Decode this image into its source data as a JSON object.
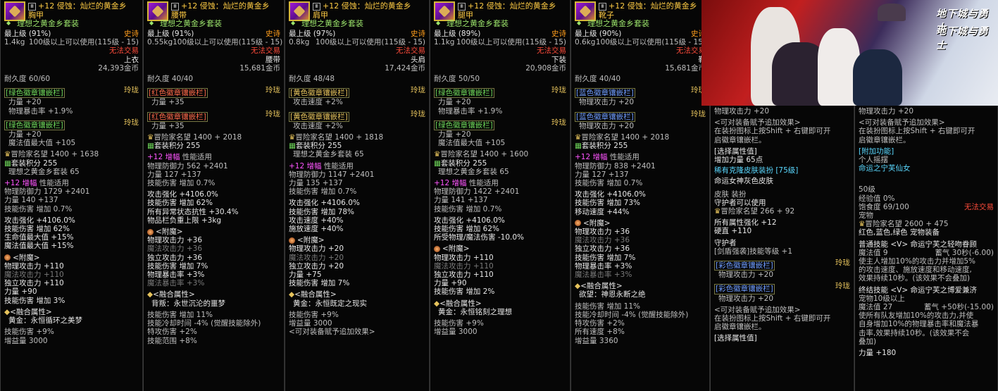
{
  "panels": [
    {
      "title": "+12 侵蚀：灿烂的黄金乡",
      "slot_name": "胸甲",
      "set_name": "理想之黄金乡套装",
      "grade": "最上级 (91%)",
      "rarity": "史诗",
      "weight": "1.4kg",
      "level_req": "100级以上可以使用(115级 - 15)",
      "trade": "无法交易",
      "type": "上衣",
      "price": "24,393金币",
      "durability": "耐久度 60/60",
      "sockets": [
        {
          "name": "[绿色徽章镶嵌栏]",
          "tag": "玲珑",
          "lines": [
            "力量 +20",
            "物理暴击率 +1.9%"
          ]
        },
        {
          "name": "[绿色徽章镶嵌栏]",
          "tag": "玲珑",
          "lines": [
            "力量 +20",
            "魔法值最大值 +105"
          ]
        }
      ],
      "fame": "冒险家名望 1400 + 1638",
      "set_points": "套装积分 255",
      "set_points_name": "理想之黄金乡套装 65",
      "amp_title": "+12 增幅",
      "amp_suffix": "性能适用",
      "stats": [
        "物理防御力 1729 +2401",
        "力量 140 +137",
        "技能伤害 增加 0.7%"
      ],
      "options": [
        "攻击强化 +4106.0%",
        "技能伤害 增加 62%",
        "生命值最大值 +15%",
        "魔法值最大值 +15%"
      ],
      "enchant_title": "<附魔>",
      "enchant": [
        "物理攻击力 +110",
        "魔法攻击力 +110",
        "独立攻击力 +110",
        "力量 +90",
        "技能伤害 增加 3%"
      ],
      "fusion_title": "<融合属性>",
      "fusion": "黄金：永恒循环之美梦",
      "tail": [
        "技能伤害 +9%",
        "增益量 3000"
      ]
    },
    {
      "title": "+12 侵蚀：灿烂的黄金乡",
      "slot_name": "腰带",
      "set_name": "理想之黄金乡套装",
      "grade": "最上级 (91%)",
      "rarity": "史诗",
      "weight": "0.55kg",
      "level_req": "100级以上可以使用(115级 - 15)",
      "trade": "无法交易",
      "type": "腰带",
      "price": "15,681金币",
      "durability": "耐久度 40/40",
      "sockets": [
        {
          "name": "[红色徽章镶嵌栏]",
          "tag": "玲珑",
          "lines": [
            "力量 +35"
          ]
        },
        {
          "name": "[红色徽章镶嵌栏]",
          "tag": "玲珑",
          "lines": [
            "力量 +35"
          ]
        }
      ],
      "fame": "冒险家名望 1400 + 2018",
      "set_points": "套装积分 255",
      "set_points_name": "",
      "amp_title": "+12 增幅",
      "amp_suffix": "性能适用",
      "stats": [
        "物理防御力 562 +2401",
        "力量 127 +137",
        "技能伤害 增加 0.7%"
      ],
      "options": [
        "攻击强化 +4106.0%",
        "技能伤害 增加 62%",
        "所有异常状态抗性 +30.4%",
        "物品栏负重上限 +3kg"
      ],
      "enchant_title": "<附魔>",
      "enchant": [
        "物理攻击力 +36",
        "魔法攻击力 +36",
        "独立攻击力 +36",
        "技能伤害 增加 7%",
        "物理暴击率 +3%",
        "魔法暴击率 +3%"
      ],
      "fusion_title": "<融合属性>",
      "fusion": "背叛：永世沉沦的噩梦",
      "tail": [
        "技能伤害 增加 11%",
        "技能冷却时间 -4% (觉醒技能除外)",
        "特攻伤害 +2%",
        "技能范围 +8%"
      ]
    },
    {
      "title": "+12 侵蚀：灿烂的黄金乡",
      "slot_name": "肩甲",
      "set_name": "理想之黄金乡套装",
      "grade": "最上级 (97%)",
      "rarity": "史诗",
      "weight": "0.8kg",
      "level_req": "100级以上可以使用(115级 - 15)",
      "trade": "无法交易",
      "type": "头肩",
      "price": "17,424金币",
      "durability": "耐久度 48/48",
      "sockets": [
        {
          "name": "[黄色徽章镶嵌栏]",
          "tag": "玲珑",
          "lines": [
            "攻击速度 +2%"
          ]
        },
        {
          "name": "[黄色徽章镶嵌栏]",
          "tag": "玲珑",
          "lines": [
            "攻击速度 +2%"
          ]
        }
      ],
      "fame": "冒险家名望 1400 + 1818",
      "set_points": "套装积分 255",
      "set_points_name": "理想之黄金乡套装 65",
      "amp_title": "+12 增幅",
      "amp_suffix": "性能适用",
      "stats": [
        "物理防御力 1147 +2401",
        "力量 135 +137",
        "技能伤害 增加 0.7%"
      ],
      "options": [
        "攻击强化 +4106.0%",
        "技能伤害 增加 78%",
        "攻击速度 +40%",
        "施放速度 +40%"
      ],
      "enchant_title": "<附魔>",
      "enchant": [
        "物理攻击力 +20",
        "魔法攻击力 +20",
        "独立攻击力 +20",
        "力量 +75",
        "技能伤害 增加 7%"
      ],
      "fusion_title": "<融合属性>",
      "fusion": "黄金：永恒既定之现实",
      "tail": [
        "技能伤害 +9%",
        "增益量 3000",
        "<可对装备赋予追加效果>"
      ]
    },
    {
      "title": "+12 侵蚀：灿烂的黄金乡",
      "slot_name": "腿甲",
      "set_name": "理想之黄金乡套装",
      "grade": "最上级 (89%)",
      "rarity": "史诗",
      "weight": "1.1kg",
      "level_req": "100级以上可以使用(115级 - 15)",
      "trade": "无法交易",
      "type": "下装",
      "price": "20,908金币",
      "durability": "耐久度 50/50",
      "sockets": [
        {
          "name": "[绿色徽章镶嵌栏]",
          "tag": "玲珑",
          "lines": [
            "力量 +20",
            "物理暴击率 +1.9%"
          ]
        },
        {
          "name": "[绿色徽章镶嵌栏]",
          "tag": "玲珑",
          "lines": [
            "力量 +20",
            "魔法值最大值 +105"
          ]
        }
      ],
      "fame": "冒险家名望 1400 + 1600",
      "set_points": "套装积分 255",
      "set_points_name": "理想之黄金乡套装 65",
      "amp_title": "+12 增幅",
      "amp_suffix": "性能适用",
      "stats": [
        "物理防御力 1422 +2401",
        "力量 141 +137",
        "技能伤害 增加 0.7%"
      ],
      "options": [
        "攻击强化 +4106.0%",
        "技能伤害 增加 62%",
        "所受物理/魔法伤害 -10.0%"
      ],
      "enchant_title": "<附魔>",
      "enchant": [
        "物理攻击力 +110",
        "魔法攻击力 +110",
        "独立攻击力 +110",
        "力量 +90",
        "技能伤害 增加 2%"
      ],
      "fusion_title": "<融合属性>",
      "fusion": "黄金：永恒铭刻之理想",
      "tail": [
        "技能伤害 +9%",
        "增益量 3000"
      ]
    },
    {
      "title": "+12 侵蚀：灿烂的黄金乡",
      "slot_name": "靴子",
      "set_name": "理想之黄金乡套装",
      "grade": "最上级 (90%)",
      "rarity": "史诗",
      "weight": "0.6kg",
      "level_req": "100级以上可以使用(115级 - 15)",
      "trade": "无法交易",
      "type": "鞋",
      "price": "15,681金币",
      "durability": "耐久度 40/40",
      "sockets": [
        {
          "name": "[蓝色徽章镶嵌栏]",
          "tag": "玲珑",
          "lines": [
            "物理攻击力 +20"
          ]
        },
        {
          "name": "[蓝色徽章镶嵌栏]",
          "tag": "玲珑",
          "lines": [
            "物理攻击力 +20"
          ]
        }
      ],
      "fame": "冒险家名望 1400 + 2018",
      "set_points": "套装积分 255",
      "set_points_name": "",
      "amp_title": "+12 增幅",
      "amp_suffix": "性能适用",
      "stats": [
        "物理防御力 838 +2401",
        "力量 127 +137",
        "技能伤害 增加 0.7%"
      ],
      "options": [
        "攻击强化 +4106.0%",
        "技能伤害 增加 73%",
        "移动速度 +44%"
      ],
      "enchant_title": "<附魔>",
      "enchant": [
        "物理攻击力 +36",
        "魔法攻击力 +36",
        "独立攻击力 +36",
        "技能伤害 增加 7%",
        "物理暴击率 +3%",
        "魔法暴击率 +3%"
      ],
      "fusion_title": "<融合属性>",
      "fusion": "欲望：神恩永断之绝",
      "tail": [
        "技能伤害 增加 11%",
        "技能冷却时间 -4% (觉醒技能除外)",
        "特攻伤害 +2%",
        "所有速度 +8%",
        "增益量 3360"
      ]
    }
  ],
  "panel6": {
    "top_line": "物理攻击力 +20",
    "addon_title": "<可对装备赋予追加效果>",
    "addon_desc": [
      "在装扮图标上按Shift + 右键即可开",
      "启徽章镶嵌栏。"
    ],
    "choose": "[选择属性值]",
    "choose_val": "增加力量 65点",
    "skin_title": "稀有克隆皮肤装扮 [75级]",
    "skin_name": "命运女神灰色皮肤",
    "skin_type": "皮肤 装扮",
    "guardian_use": "守护者可以使用",
    "fame": "冒险家名望 266 + 92",
    "all_attr": "所有属性强化 +12",
    "hardness": "硬直 +110",
    "guardian": "守护者",
    "skill_lv": "[剑盾强袭]技能等级 +1",
    "sock1": "[彩色徽章镶嵌栏]",
    "sock1_tag": "玲珑",
    "sock1_val": "物理攻击力 +20",
    "sock2": "[彩色徽章镶嵌栏]",
    "sock2_tag": "玲珑",
    "sock2_val": "物理攻击力 +20",
    "addon2_title": "<可对装备赋予追加效果>",
    "addon2_desc": [
      "在装扮图标上按Shift + 右键即可开",
      "启徽章镶嵌栏。"
    ],
    "choose2": "[选择属性值]"
  },
  "panel7": {
    "top_line": "物理攻击力 +20",
    "addon_title": "<可对装备赋予追加效果>",
    "addon_desc": [
      "在装扮图标上按Shift + 右键即可开",
      "启徽章镶嵌栏。"
    ],
    "extra_title": "[附加功能]",
    "extra_val": "个人摇摆",
    "pet_name": "命运之宁芙仙女",
    "pet_level": "50级",
    "pet_exp": "经验值 0%",
    "pet_full": "饱食度 69/100",
    "pet_trade": "无法交易",
    "pet_kind": "宠物",
    "fame": "冒险家名望 2600 + 475",
    "equip_colors": "红色,蓝色,绿色 宠物装备",
    "skill1_title": "普通技能 <V> 命运宁芙之轻吻眷顾",
    "skill1_mp": "魔法值 9",
    "skill1_cd": "蓄气 30秒(-6.00)",
    "skill1_desc": [
      "使主人增加10%的攻击力并增加5%",
      "的攻击速度、施放速度和移动速度,",
      "效果持续10秒。(该效果不会叠加)"
    ],
    "skill2_title": "终结技能 <V> 命运宁芙之博爱兼济",
    "skill2_req": "宠物10级以上",
    "skill2_mp": "魔法值 27",
    "skill2_cd": "蓄气 +50秒(-15.00)",
    "skill2_desc": [
      "使所有队友增加10%的攻击力,并使",
      "自身增加10%的物理暴击率和魔法暴",
      "击率,效果持续10秒。(该效果不会",
      "叠加)"
    ],
    "last": "力量 +180"
  },
  "banner": {
    "logo1": "地下城与勇士",
    "logo2": "地下城与勇士"
  },
  "colors": {
    "title": "#ffcc44",
    "set": "#9be36b",
    "epic": "#ff9d1c",
    "untradable": "#ff4b3a",
    "amp": "#ff55ff"
  }
}
